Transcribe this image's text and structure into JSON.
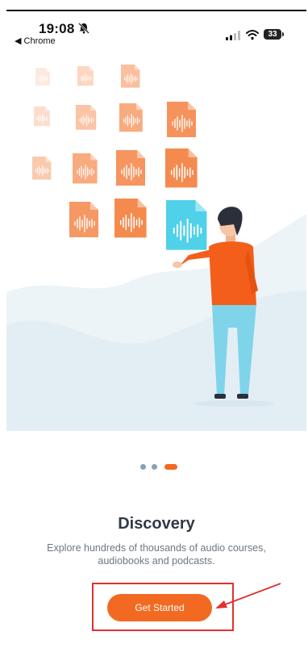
{
  "status_bar": {
    "time": "19:08",
    "back_label": "Chrome",
    "battery": "33"
  },
  "onboarding": {
    "title": "Discovery",
    "description": "Explore hundreds of thousands of audio courses, audiobooks and podcasts.",
    "cta_label": "Get Started",
    "pagination": {
      "total": 3,
      "active": 3
    }
  },
  "colors": {
    "accent": "#f26a21",
    "file_tile": "#f58a4e",
    "highlight_file": "#4fd1ea",
    "shirt": "#f45e1b",
    "pants": "#7fd4ea",
    "background_wave": "#eaf2f7",
    "annotation": "#e03030"
  },
  "icons": {
    "mute": "bell-slash-icon",
    "back": "back-arrow-icon",
    "signal": "cell-signal-icon",
    "wifi": "wifi-icon",
    "battery": "battery-icon",
    "file": "audio-file-icon"
  }
}
